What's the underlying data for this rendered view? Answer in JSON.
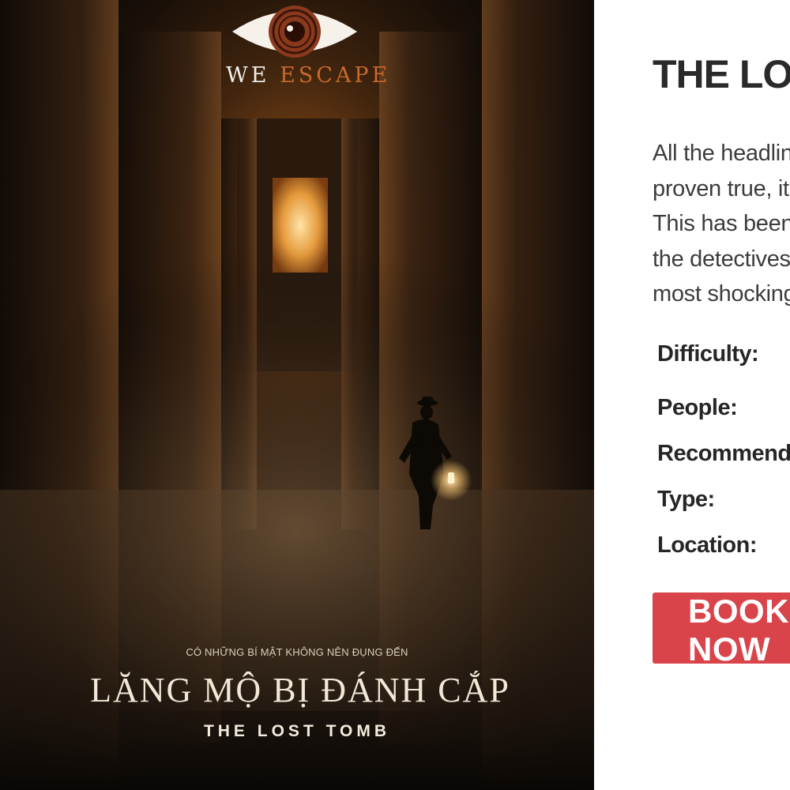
{
  "poster": {
    "logo": {
      "word_we": "WE",
      "word_escape": "ESCAPE"
    },
    "tagline": "CÓ NHỮNG BÍ MẬT KHÔNG NÊN ĐỤNG ĐẾN",
    "title_vi": "LĂNG MỘ BỊ ĐÁNH CẮP",
    "title_en": "THE LOST TOMB",
    "colors": {
      "brand_orange": "#c8692c",
      "text_light": "#f1e8d6"
    }
  },
  "room": {
    "title": "THE LOST TOMB",
    "description_lines": [
      "All the headlines",
      "proven true, it",
      "This has been",
      "the detectives",
      "most shocking"
    ],
    "facts": {
      "difficulty_label": "Difficulty:",
      "people_label": "People:",
      "recommended_label": "Recommended",
      "type_label": "Type:",
      "location_label": "Location:"
    },
    "book_button": "BOOK NOW",
    "colors": {
      "book_button_bg": "#d9434a",
      "title_text": "#2a2a2a"
    }
  }
}
